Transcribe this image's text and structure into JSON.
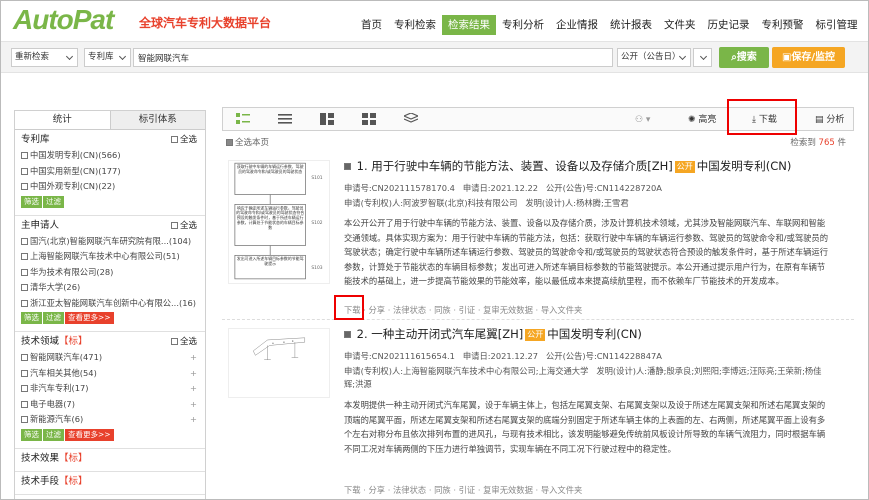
{
  "header": {
    "logo": "AutoPat",
    "subtitle": "全球汽车专利大数据平台",
    "nav": [
      "首页",
      "专利检索",
      "检索结果",
      "专利分析",
      "企业情报",
      "统计报表",
      "文件夹",
      "历史记录",
      "专利预警",
      "标引管理"
    ],
    "active_nav": 2
  },
  "search": {
    "mode": "重新检索",
    "database": "专利库",
    "query": "智能网联汽车",
    "sort": "公开（公告日）",
    "search_label": "搜索",
    "save_label": "保存/监控"
  },
  "sidebar": {
    "tabs": [
      "统计",
      "标引体系"
    ],
    "select_all": "全选",
    "facets": [
      {
        "title": "专利库",
        "tag": "",
        "items": [
          "中国发明专利(CN)(566)",
          "中国实用新型(CN)(177)",
          "中国外观专利(CN)(22)"
        ],
        "buttons": [
          "筛选",
          "过滤"
        ],
        "plus": false
      },
      {
        "title": "主申请人",
        "tag": "",
        "items": [
          "国汽(北京)智能网联汽车研究院有限...(104)",
          "上海智能网联汽车技术中心有限公司(51)",
          "华为技术有限公司(28)",
          "清华大学(26)",
          "浙江亚太智能网联汽车创新中心有限公...(16)"
        ],
        "buttons": [
          "筛选",
          "过滤",
          "查看更多>>"
        ],
        "plus": false
      },
      {
        "title": "技术领域",
        "tag": "【标】",
        "items": [
          "智能网联汽车(471)",
          "汽车相关其他(54)",
          "非汽车专利(17)",
          "电子电器(7)",
          "新能源汽车(6)"
        ],
        "buttons": [
          "筛选",
          "过滤",
          "查看更多>>"
        ],
        "plus": true
      },
      {
        "title": "技术效果",
        "tag": "【标】",
        "items": [],
        "buttons": [],
        "plus": false
      },
      {
        "title": "技术手段",
        "tag": "【标】",
        "items": [],
        "buttons": [],
        "plus": false
      }
    ]
  },
  "toolbar": {
    "highlight": "高亮",
    "download": "下载",
    "analyze": "分析",
    "select_page": "全选本页",
    "count_prefix": "检索到",
    "count": "765",
    "count_suffix": "件"
  },
  "results": [
    {
      "title": "1. 用于行驶中车辆的节能方法、装置、设备以及存储介质[ZH]",
      "status": "公开",
      "kind": "中国发明专利(CN)",
      "app_no": "申请号:CN202111578170.4",
      "app_date": "申请日:2021.12.22",
      "pub_no": "公开(公告)号:CN114228720A",
      "applicant": "申请(专利权)人:阿波罗智联(北京)科技有限公司",
      "inventor": "发明(设计)人:杨林腾;王雪君",
      "abstract": "本公开公开了用于行驶中车辆的节能方法、装置、设备以及存储介质，涉及计算机技术领域，尤其涉及智能网联汽车、车联网和智能交通领域。具体实现方案为：用于行驶中车辆的节能方法，包括：获取行驶中车辆的车辆运行参数、驾驶员的驾驶命令和/或驾驶员的驾驶状态；确定行驶中车辆所述车辆运行参数、驾驶员的驾驶命令和/或驾驶员的驾驶状态符合预设的触发条件时，基于所述车辆运行参数，计算处于节能状态的车辆目标参数；发出可进入所述车辆目标参数的节能驾驶提示。本公开通过提示用户行为，在原有车辆节能技术的基础上，进一步提高节能效果的节能效率，能以最低成本来提高续航里程，而不依赖车厂节能技术的开发成本。",
      "actions": "下载 · 分享 · 法律状态 · 同族 · 引证 · 复审无效数据 · 导入文件夹",
      "flow": [
        "获取行驶中车辆的车辆运行参数、驾驶员的驾驶命令和/或驾驶员的驾驶状态",
        "响应于确定所述车辆运行参数，驾驶员的驾驶命令和/或驾驶员的驾驶状态符合预设的触发条件时，基于所述车辆运行参数，计算处于节能状态的车辆目标参数",
        "发出可进入所述车辆目标参数的节能驾驶提示"
      ],
      "flow_labels": [
        "S101",
        "S102",
        "S103"
      ]
    },
    {
      "title": "2. 一种主动开闭式汽车尾翼[ZH]",
      "status": "公开",
      "kind": "中国发明专利(CN)",
      "app_no": "申请号:CN202111615654.1",
      "app_date": "申请日:2021.12.27",
      "pub_no": "公开(公告)号:CN114228847A",
      "applicant": "申请(专利权)人:上海智能网联汽车技术中心有限公司;上海交通大学",
      "inventor": "发明(设计)人:潘静;殷承良;刘熙阳;李博远;汪际亮;王荣新;杨佳辉;洪源",
      "abstract": "本发明提供一种主动开闭式汽车尾翼，设于车辆主体上，包括左尾翼支架、右尾翼支架以及设于所述左尾翼支架和所述右尾翼支架的顶端的尾翼平面，所述左尾翼支架和所述右尾翼支架的底端分别固定于所述车辆主体的上表面的左、右两侧，所述尾翼平面上设有多个左右对称分布且依次排列布置的进风孔，与现有技术相比，该发明能够避免传统前风板设计所导致的车辆气流阻力，同时根据车辆不同工况对车辆两侧的下压力进行单独调节，实现车辆在不同工况下行驶过程中的稳定性。",
      "actions": "下载 · 分享 · 法律状态 · 同族 · 引证 · 复审无效数据 · 导入文件夹"
    }
  ]
}
